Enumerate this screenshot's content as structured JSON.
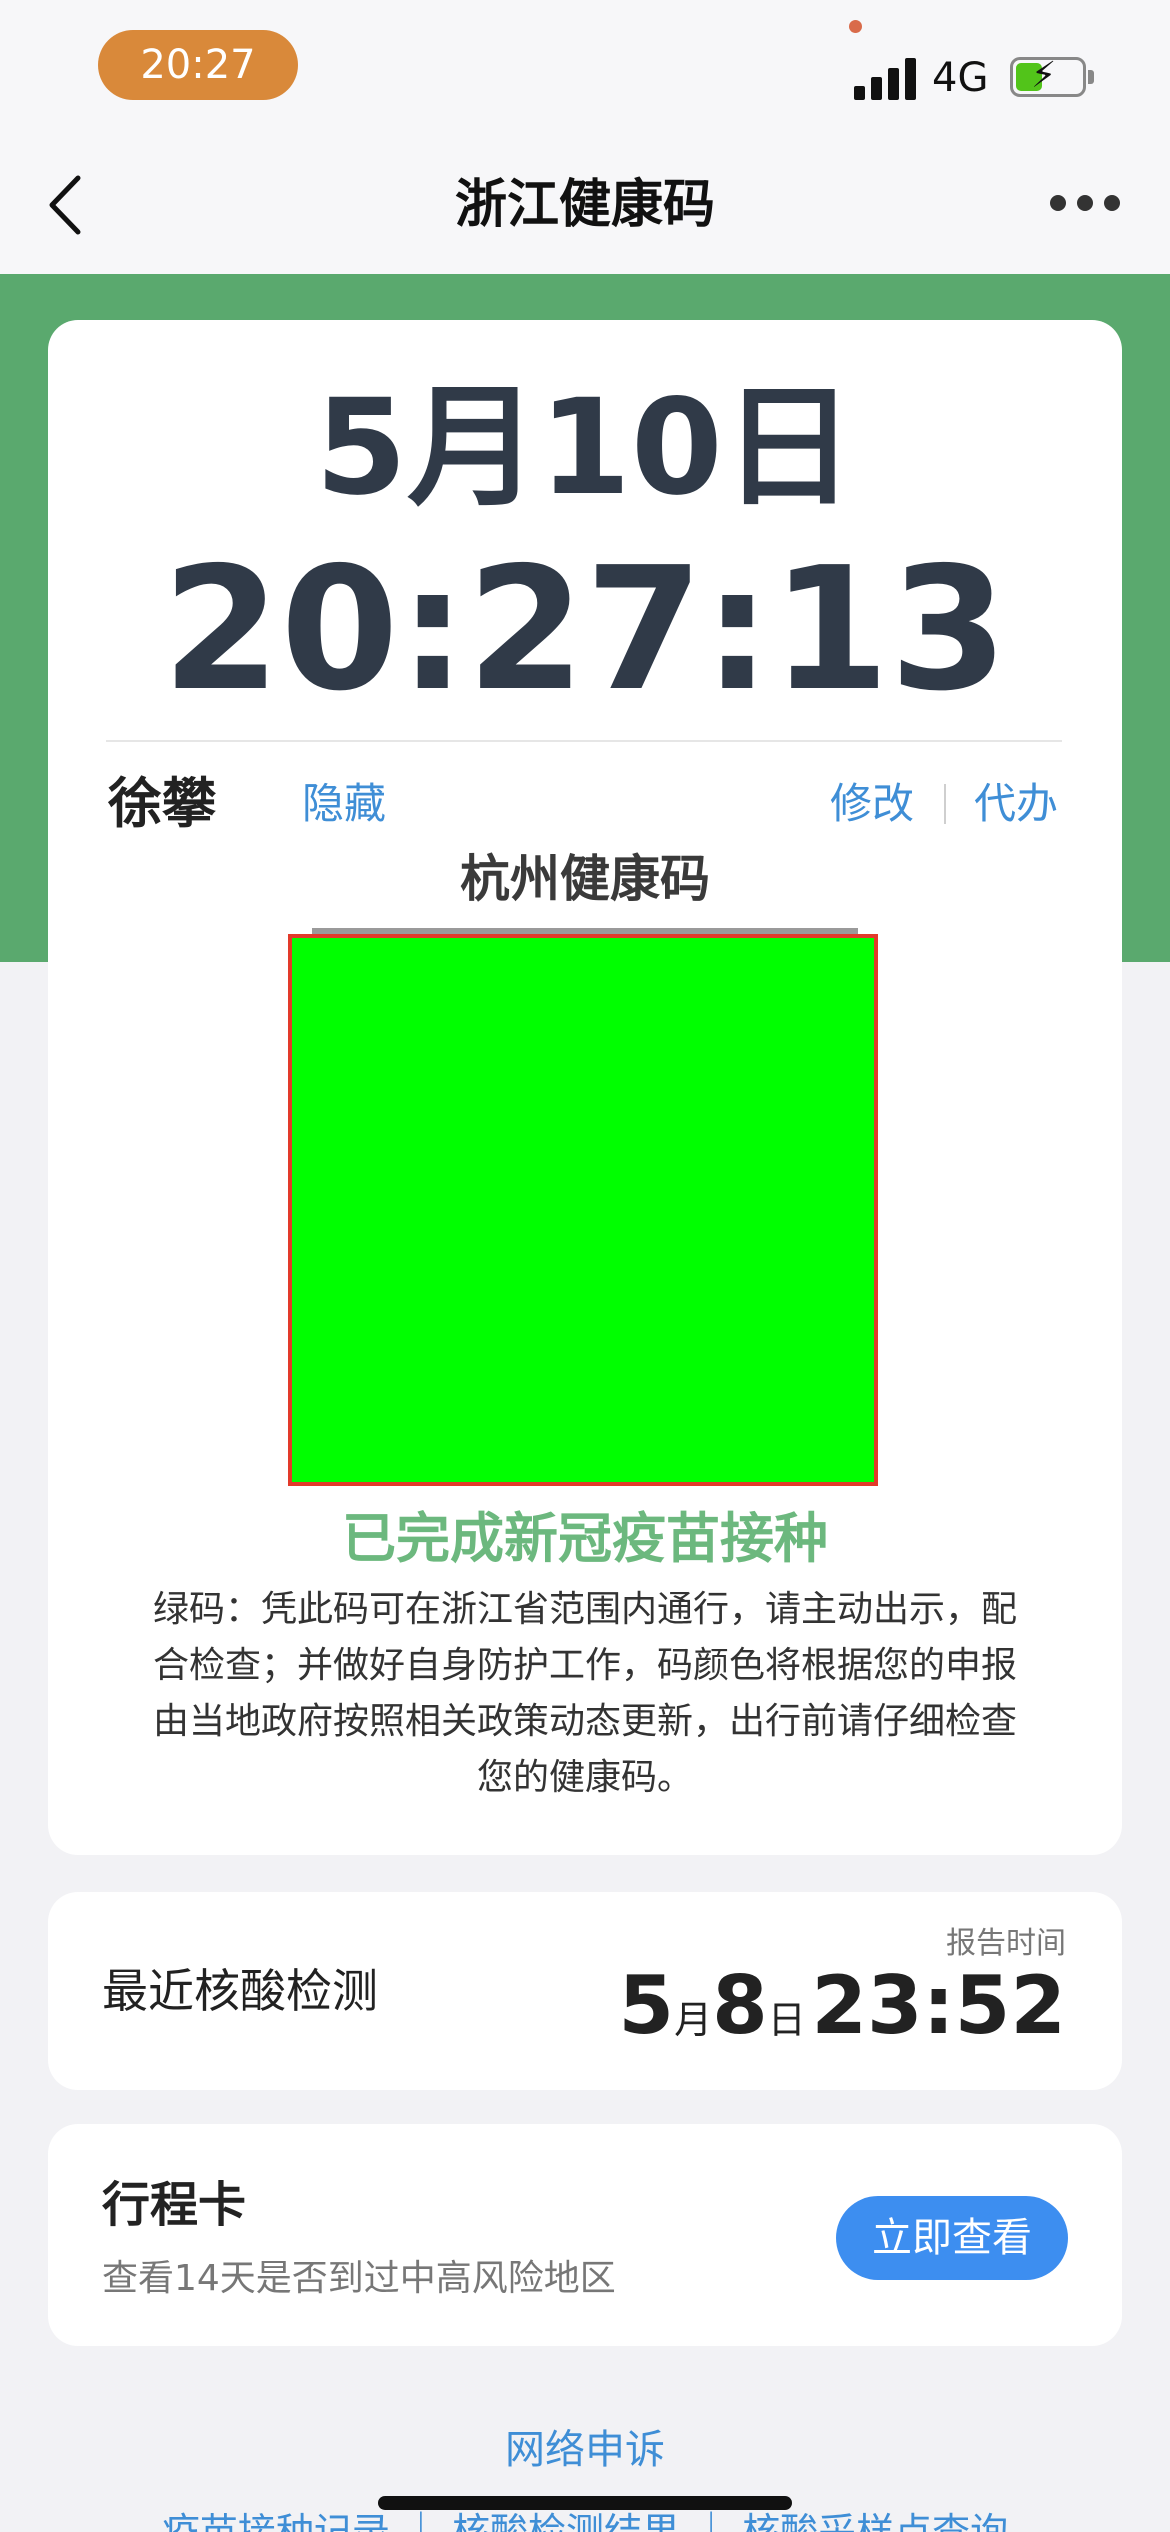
{
  "status_bar": {
    "time": "20:27",
    "network": "4G",
    "signal_icon": "signal-bars-icon",
    "battery_icon": "battery-charging-icon",
    "battery_level": 0.4
  },
  "nav": {
    "title": "浙江健康码",
    "back_icon": "chevron-left-icon",
    "more_icon": "more-dots-icon"
  },
  "clock": {
    "date": "5月10日",
    "time": "20:27:13"
  },
  "user": {
    "name": "徐攀",
    "hide_label": "隐藏",
    "edit_label": "修改",
    "proxy_label": "代办"
  },
  "health_code": {
    "title": "杭州健康码",
    "color": "#00ff00",
    "vaccine_status": "已完成新冠疫苗接种",
    "notice": "绿码：凭此码可在浙江省范围内通行，请主动出示，配合检查；并做好自身防护工作，码颜色将根据您的申报由当地政府按照相关政策动态更新，出行前请仔细检查您的健康码。"
  },
  "nucleic_test": {
    "label": "最近核酸检测",
    "report_time_label": "报告时间",
    "month": "5",
    "month_unit": "月",
    "day": "8",
    "day_unit": "日",
    "time": "23:52"
  },
  "trip_card": {
    "title": "行程卡",
    "description": "查看14天是否到过中高风险地区",
    "button_label": "立即查看"
  },
  "footer": {
    "appeal_label": "网络申诉",
    "links": "疫苗接种记录 ｜ 核酸检测结果 ｜ 核酸采样点查询"
  },
  "colors": {
    "accent_green": "#5aa96e",
    "link_blue": "#3f8ed6",
    "button_blue": "#3d8ef0"
  }
}
